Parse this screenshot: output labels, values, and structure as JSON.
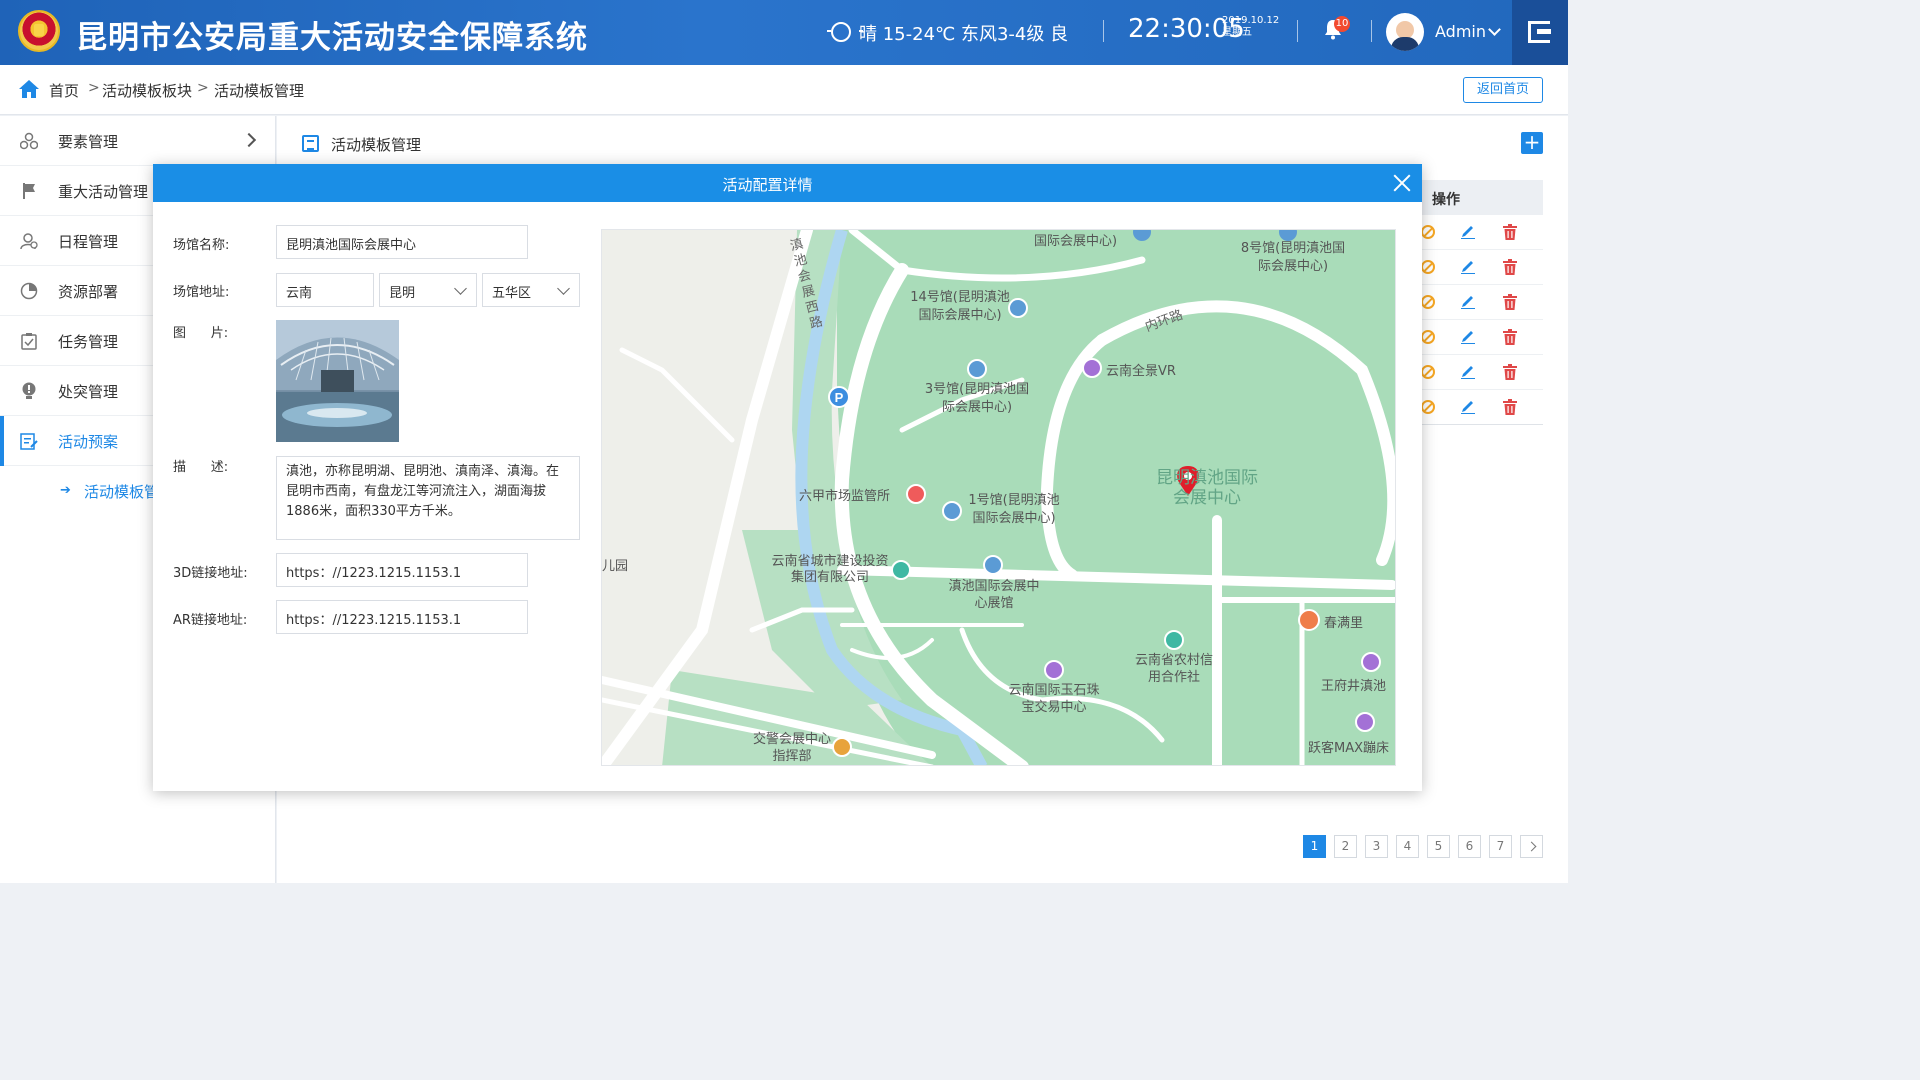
{
  "header": {
    "title": "昆明市公安局重大活动安全保障系统",
    "weather": "晴  15-24℃  东风3-4级  良",
    "time": "22:30:05",
    "date": "2019.10.12",
    "weekday": "星期五",
    "notification_count": "10",
    "user": "Admin"
  },
  "breadcrumb": {
    "items": [
      "首页",
      "活动模板板块",
      "活动模板管理"
    ],
    "separator": ">",
    "back_label": "返回首页"
  },
  "sidebar": {
    "items": [
      {
        "label": "要素管理",
        "icon": "elements-icon"
      },
      {
        "label": "重大活动管理",
        "icon": "flag-icon"
      },
      {
        "label": "日程管理",
        "icon": "schedule-icon"
      },
      {
        "label": "资源部署",
        "icon": "resource-icon"
      },
      {
        "label": "任务管理",
        "icon": "task-icon"
      },
      {
        "label": "处突管理",
        "icon": "alert-icon"
      },
      {
        "label": "活动预案",
        "icon": "plan-icon"
      }
    ],
    "sub_item": "活动模板管理"
  },
  "main": {
    "title": "活动模板管理",
    "ops_header": "操作",
    "pagination": [
      "1",
      "2",
      "3",
      "4",
      "5",
      "6",
      "7"
    ],
    "current_page": "1"
  },
  "modal": {
    "title": "活动配置详情",
    "fields": {
      "venue_name_label": "场馆名称:",
      "venue_name": "昆明滇池国际会展中心",
      "address_label": "场馆地址:",
      "province": "云南",
      "city": "昆明",
      "district": "五华区",
      "photo_label": "图      片:",
      "desc_label": "描      述:",
      "description": "滇池，亦称昆明湖、昆明池、滇南泽、滇海。在昆明市西南，有盘龙江等河流注入，湖面海拔1886米，面积330平方千米。",
      "link3d_label": "3D链接地址:",
      "link3d": "https：//1223.1215.1153.1",
      "linkar_label": "AR链接地址:",
      "linkar": "https：//1223.1215.1153.1"
    },
    "map": {
      "center_label": "昆明滇池国际会展中心",
      "roads": [
        "滇池会展西路",
        "内环路"
      ],
      "pois": [
        "国际会展中心)",
        "8号馆(昆明滇池国际会展中心)",
        "14号馆(昆明滇池国际会展中心)",
        "3号馆(昆明滇池国际会展中心)",
        "云南全景VR",
        "六甲市场监管所",
        "1号馆(昆明滇池国际会展中心)",
        "云南省城市建设投资集团有限公司",
        "滇池国际会展中心展馆",
        "儿园",
        "春满里",
        "云南省农村信用合作社",
        "云南国际玉石珠宝交易中心",
        "王府井滇池",
        "交警会展中心指挥部",
        "跃客MAX蹦床"
      ]
    }
  }
}
